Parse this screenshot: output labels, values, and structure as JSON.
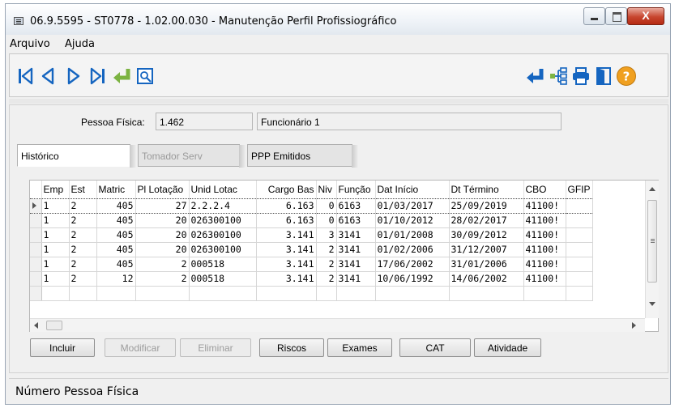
{
  "window": {
    "title": "06.9.5595 - ST0778 - 1.02.00.030 - Manutenção Perfil Profissiográfico",
    "close_glyph": "X"
  },
  "menu": {
    "items": [
      "Arquivo",
      "Ajuda"
    ]
  },
  "toolbar": {
    "left_icons": [
      "first-record-icon",
      "previous-record-icon",
      "next-record-icon",
      "last-record-icon",
      "enter-confirm-icon",
      "preview-search-icon"
    ],
    "right_icons": [
      "enter-return-icon",
      "tree-structure-icon",
      "printer-icon",
      "exit-door-icon",
      "help-icon"
    ],
    "help_glyph": "?",
    "accent_blue": "#1565c0",
    "accent_green": "#7cb342",
    "help_orange": "#f0a020"
  },
  "header": {
    "pessoa_label": "Pessoa Física:",
    "pessoa_value": "1.462",
    "funcionario_value": "Funcionário 1"
  },
  "tabs": [
    {
      "label": "Histórico",
      "state": "active"
    },
    {
      "label": "Tomador Serv",
      "state": "disabled"
    },
    {
      "label": "PPP Emitidos",
      "state": "normal"
    }
  ],
  "grid": {
    "columns": [
      "Emp",
      "Est",
      "Matric",
      "Pl Lotação",
      "Unid Lotac",
      "Cargo Bas",
      "Niv",
      "Função",
      "Dat Início",
      "Dt Término",
      "CBO",
      "GFIP"
    ],
    "rows": [
      [
        "1",
        "2",
        "405",
        "27",
        "2.2.2.4",
        "6.163",
        "0",
        "6163",
        "01/03/2017",
        "25/09/2019",
        "41100!",
        ""
      ],
      [
        "1",
        "2",
        "405",
        "20",
        "026300100",
        "6.163",
        "0",
        "6163",
        "01/10/2012",
        "28/02/2017",
        "41100!",
        ""
      ],
      [
        "1",
        "2",
        "405",
        "20",
        "026300100",
        "3.141",
        "3",
        "3141",
        "01/01/2008",
        "30/09/2012",
        "41100!",
        ""
      ],
      [
        "1",
        "2",
        "405",
        "20",
        "026300100",
        "3.141",
        "2",
        "3141",
        "01/02/2006",
        "31/12/2007",
        "41100!",
        ""
      ],
      [
        "1",
        "2",
        "405",
        "2",
        "000518",
        "3.141",
        "2",
        "3141",
        "17/06/2002",
        "31/01/2006",
        "41100!",
        ""
      ],
      [
        "1",
        "2",
        "12",
        "2",
        "000518",
        "3.141",
        "2",
        "3141",
        "10/06/1992",
        "14/06/2002",
        "41100!",
        ""
      ]
    ],
    "selected_row": 0
  },
  "buttons": {
    "incluir": "Incluir",
    "modificar": "Modificar",
    "eliminar": "Eliminar",
    "riscos": "Riscos",
    "exames": "Exames",
    "cat": "CAT",
    "atividade": "Atividade"
  },
  "status": {
    "text": "Número Pessoa Física"
  }
}
